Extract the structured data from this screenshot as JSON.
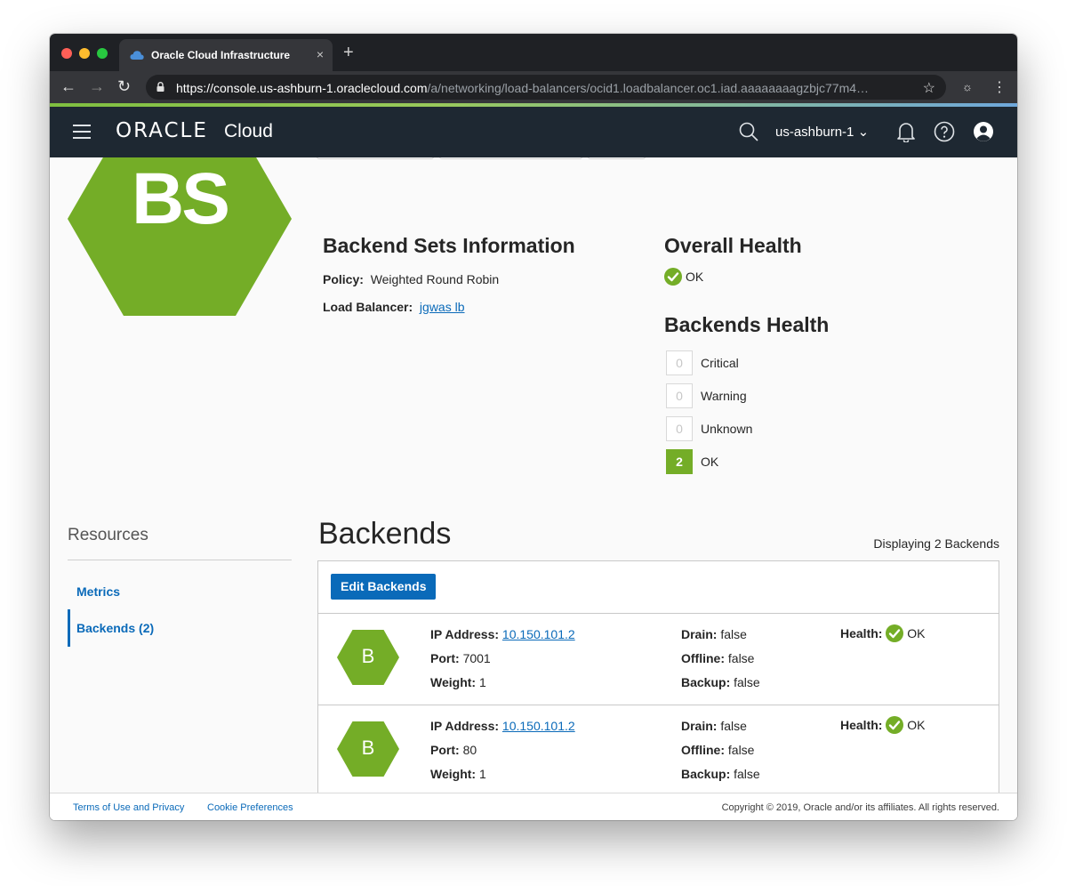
{
  "browser": {
    "tab_title": "Oracle Cloud Infrastructure",
    "tab_close": "×",
    "new_tab": "+",
    "url_host": "https://console.us-ashburn-1.oraclecloud.com",
    "url_path": "/a/networking/load-balancers/ocid1.loadbalancer.oc1.iad.aaaaaaaagzbjc77m4…",
    "icons": [
      "back-icon",
      "forward-icon",
      "reload-icon",
      "lock-icon",
      "star-icon",
      "incognito-icon",
      "menu-icon"
    ]
  },
  "header": {
    "brand": "ORACLE",
    "product": "Cloud",
    "region": "us-ashburn-1",
    "colors": {
      "bg": "#1e2832"
    }
  },
  "resource": {
    "badge": "BS",
    "badge_color": "#74ad27"
  },
  "info": {
    "title": "Backend Sets Information",
    "policy_label": "Policy:",
    "policy_value": "Weighted Round Robin",
    "lb_label": "Load Balancer:",
    "lb_value": "jgwas lb"
  },
  "overall_health": {
    "title": "Overall Health",
    "status": "OK"
  },
  "backends_health": {
    "title": "Backends Health",
    "items": [
      {
        "count": "0",
        "label": "Critical"
      },
      {
        "count": "0",
        "label": "Warning"
      },
      {
        "count": "0",
        "label": "Unknown"
      },
      {
        "count": "2",
        "label": "OK"
      }
    ]
  },
  "resources": {
    "title": "Resources",
    "items": [
      {
        "label": "Metrics"
      },
      {
        "label": "Backends (2)"
      }
    ]
  },
  "backends": {
    "title": "Backends",
    "displaying": "Displaying 2 Backends",
    "edit_button": "Edit Backends",
    "rows": [
      {
        "badge": "B",
        "ip_label": "IP Address:",
        "ip": "10.150.101.2",
        "port_label": "Port:",
        "port": "7001",
        "weight_label": "Weight:",
        "weight": "1",
        "drain_label": "Drain:",
        "drain": "false",
        "offline_label": "Offline:",
        "offline": "false",
        "backup_label": "Backup:",
        "backup": "false",
        "health_label": "Health:",
        "health": "OK"
      },
      {
        "badge": "B",
        "ip_label": "IP Address:",
        "ip": "10.150.101.2",
        "port_label": "Port:",
        "port": "80",
        "weight_label": "Weight:",
        "weight": "1",
        "drain_label": "Drain:",
        "drain": "false",
        "offline_label": "Offline:",
        "offline": "false",
        "backup_label": "Backup:",
        "backup": "false",
        "health_label": "Health:",
        "health": "OK"
      }
    ]
  },
  "footer": {
    "terms": "Terms of Use and Privacy",
    "cookies": "Cookie Preferences",
    "copyright": "Copyright © 2019, Oracle and/or its affiliates. All rights reserved."
  }
}
